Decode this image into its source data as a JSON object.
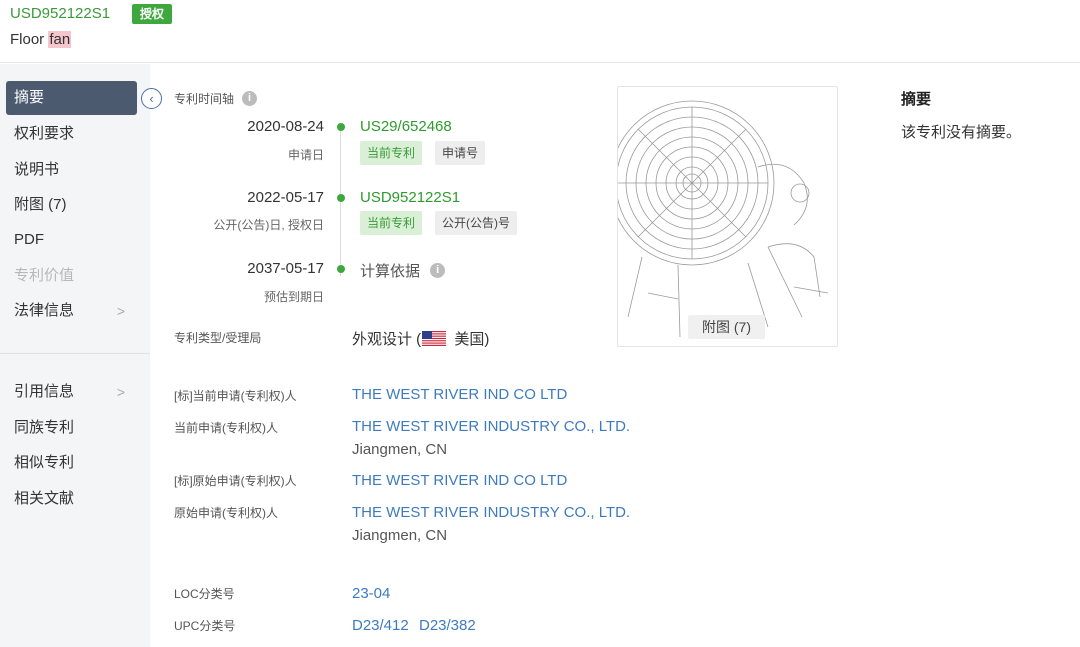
{
  "header": {
    "pub_number": "USD952122S1",
    "status_badge": "授权",
    "title_prefix": "Floor ",
    "title_highlight": "fan"
  },
  "sidebar": {
    "items": [
      {
        "label": "摘要"
      },
      {
        "label": "权利要求"
      },
      {
        "label": "说明书"
      },
      {
        "label": "附图 (7)"
      },
      {
        "label": "PDF"
      },
      {
        "label": "专利价值"
      },
      {
        "label": "法律信息"
      },
      {
        "label": "引用信息"
      },
      {
        "label": "同族专利"
      },
      {
        "label": "相似专利"
      },
      {
        "label": "相关文献"
      }
    ]
  },
  "timeline": {
    "heading": "专利时间轴",
    "events": [
      {
        "date": "2020-08-24",
        "sub": "申请日",
        "value": "US29/652468",
        "tags": [
          "当前专利",
          "申请号"
        ]
      },
      {
        "date": "2022-05-17",
        "sub": "公开(公告)日, 授权日",
        "value": "USD952122S1",
        "tags": [
          "当前专利",
          "公开(公告)号"
        ]
      },
      {
        "date": "2037-05-17",
        "sub": "预估到期日",
        "value": "计算依据"
      }
    ]
  },
  "fields": {
    "type_label": "专利类型/受理局",
    "type_value_prefix": "外观设计 (",
    "type_value_suffix": " 美国)",
    "std_current_label": "[标]当前申请(专利权)人",
    "std_current_value": "THE WEST RIVER IND CO LTD",
    "current_label": "当前申请(专利权)人",
    "current_value": "THE WEST RIVER INDUSTRY CO., LTD.",
    "current_location": "Jiangmen, CN",
    "std_original_label": "[标]原始申请(专利权)人",
    "std_original_value": "THE WEST RIVER IND CO LTD",
    "original_label": "原始申请(专利权)人",
    "original_value": "THE WEST RIVER INDUSTRY CO., LTD.",
    "original_location": "Jiangmen, CN",
    "loc_label": "LOC分类号",
    "loc_value": "23-04",
    "upc_label": "UPC分类号",
    "upc_values": [
      "D23/412",
      "D23/382"
    ]
  },
  "figure": {
    "button_label": "附图 (7)"
  },
  "abstract": {
    "title": "摘要",
    "text": "该专利没有摘要。"
  },
  "icons": {
    "info": "info-icon",
    "collapse": "chevron-left-icon",
    "flag": "us-flag-icon"
  },
  "colors": {
    "green": "#3ea83e",
    "link_blue": "#3d7bbf",
    "nav_active": "#4b5a6e"
  }
}
